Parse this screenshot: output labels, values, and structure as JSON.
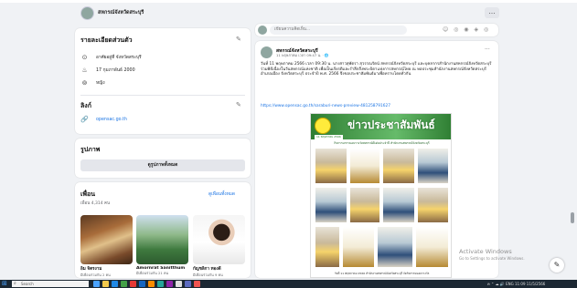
{
  "page_header": {
    "title": "สหกรณ์จังหวัดสระบุรี",
    "more_button": "…"
  },
  "intro": {
    "heading": "รายละเอียดส่วนตัว",
    "items": [
      {
        "icon": "location-pin-icon",
        "text": "อาศัยอยู่ที่ จังหวัดสระบุรี"
      },
      {
        "icon": "birthday-cake-icon",
        "text": "17 กุมภาพันธ์ 2000"
      },
      {
        "icon": "gender-icon",
        "text": "หญิง"
      }
    ],
    "links_heading": "ลิงก์",
    "links": [
      {
        "icon": "link-icon",
        "text": "opensac.go.th"
      }
    ]
  },
  "photos": {
    "heading": "รูปภาพ",
    "button": "ดูรูปภาพทั้งหมด"
  },
  "friends": {
    "heading": "เพื่อน",
    "see_all": "ดูเพื่อนทั้งหมด",
    "count": "เพื่อน 4,314 คน",
    "list": [
      {
        "name": "อิม จิตรงาม",
        "meta": "มีเพื่อนร่วมกัน 2 คน"
      },
      {
        "name": "Amornrat Sanitthum",
        "meta": "มีเพื่อนร่วมกัน 21 คน"
      },
      {
        "name": "กัญชลิกา ทองดี",
        "meta": "มีเพื่อนร่วมกัน 9 คน"
      }
    ]
  },
  "filter_bar": {
    "placeholder": "เขียนความคิดเห็น...",
    "icons": "☺ ◎ ◉ ◈ ◎"
  },
  "post": {
    "author": "สหกรณ์จังหวัดสระบุรี",
    "time": "11 พฤษภาคม เวลา 09:47 น. · 🌐",
    "text": "วันที่ 11 พฤษภาคม 2566 เวลา 09:30 น. นางสาวสุพัตรา สุวรรณรัตน์ สหกรณ์จังหวัดสระบุรี และบุคลากรสำนักงานสหกรณ์จังหวัดสระบุรี ร่วมพิธีเนื่องในวันสหกรณ์แห่งชาติ เพื่อเป็นเกียรติและรำลึกถึงพระบิดาแห่งการสหกรณ์ไทย ณ หอประชุมสำนักงานสหกรณ์จังหวัดสระบุรี อำเภอเมือง จังหวัดสระบุรี ประจำปี พ.ศ. 2566 จึงขอประชาสัมพันธ์มาเพื่อทราบโดยทั่วกัน",
    "url": "https://www.opensac.go.th/saraburi-news-preview-481258791627",
    "more": "···"
  },
  "media": {
    "banner_title": "ข่าวประชาสัมพันธ์",
    "date_tag": "11 พฤษภาคม 2566",
    "caption": "กิจกรรมการมอบรางวัลสหกรณ์ดีเด่นประจำปี สำนักงานสหกรณ์จังหวัดสระบุรี",
    "footer": "วันที่ 11 พฤษภาคม 2566 สำนักงานสหกรณ์จังหวัดสระบุรี จัดกิจกรรมมอบรางวัล"
  },
  "watermark": {
    "line1": "Activate Windows",
    "line2": "Go to Settings to activate Windows."
  },
  "taskbar": {
    "search_placeholder": "Search",
    "tray_text": "ค  ⌃  ☁  🔊  ENG  11:09  11/5/2566"
  },
  "colors": {
    "accent": "#1b74e4",
    "background": "#f0f2f5",
    "banner_green": "#2e7d32"
  }
}
